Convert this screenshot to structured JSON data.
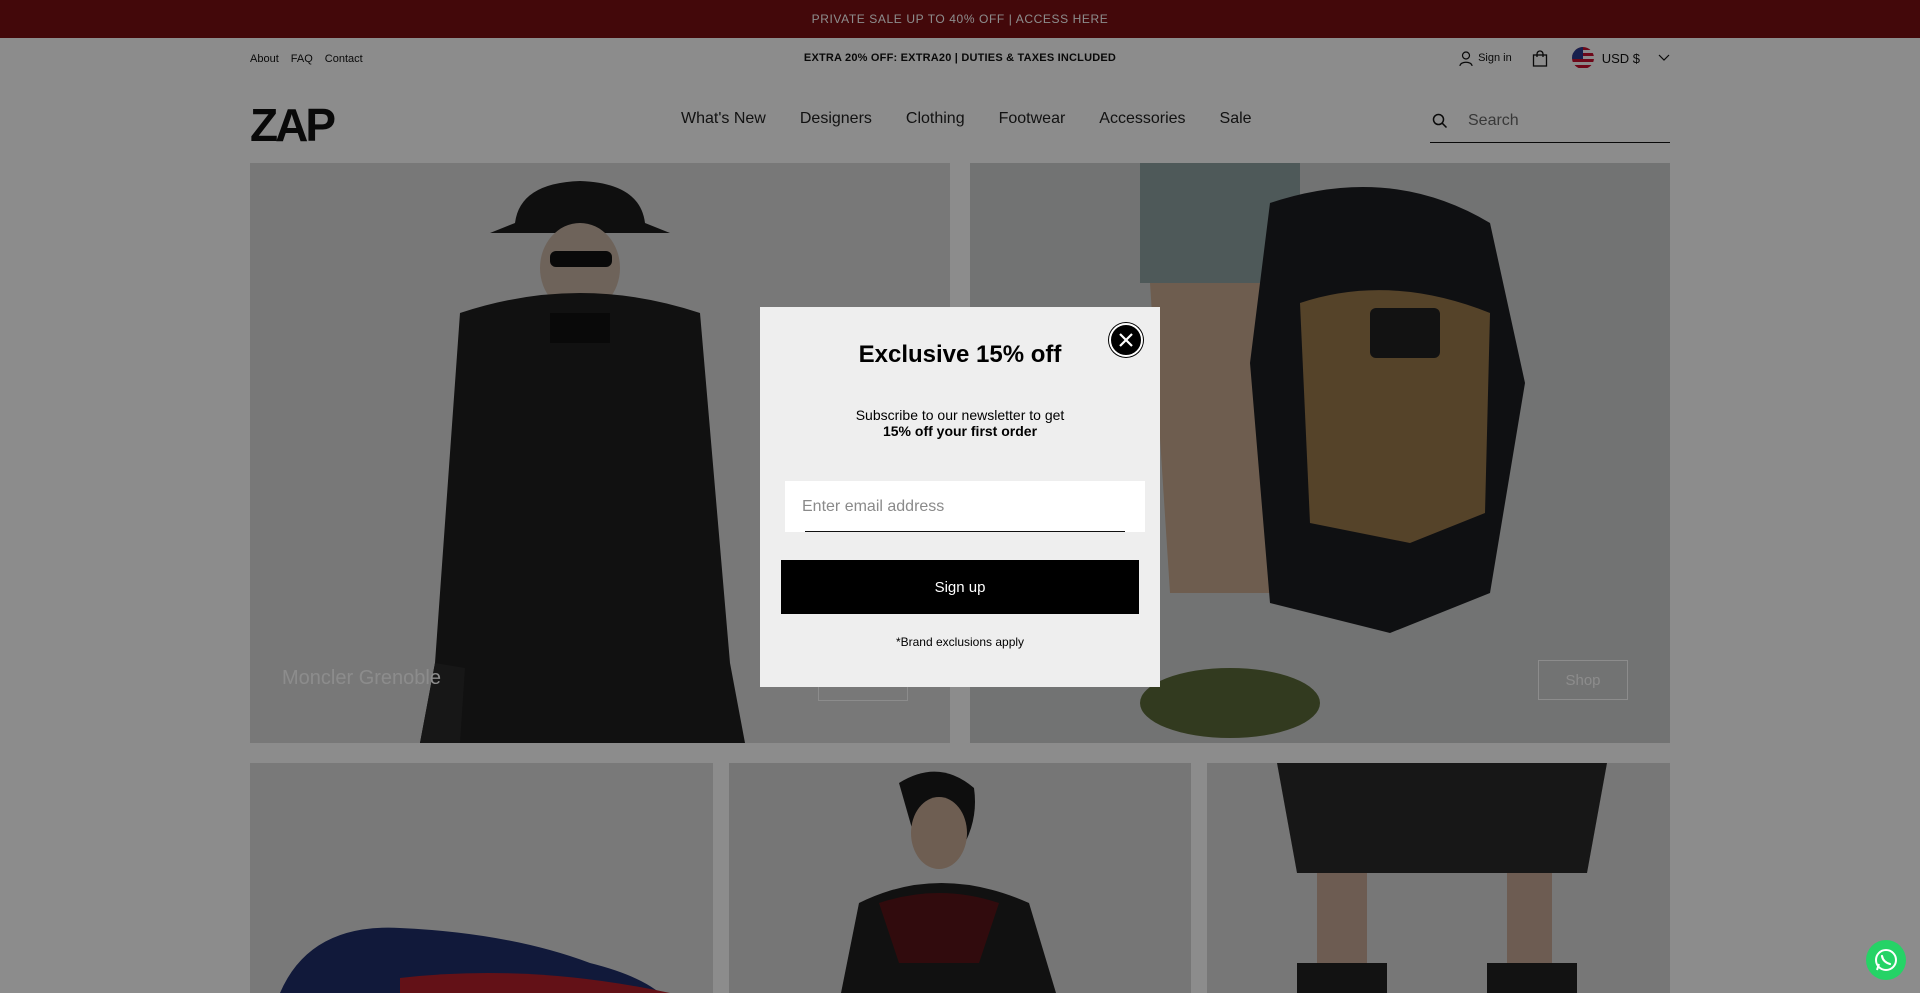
{
  "promo": {
    "text": "PRIVATE SALE UP TO 40% OFF | ACCESS HERE"
  },
  "utility": {
    "links": [
      "About",
      "FAQ",
      "Contact"
    ],
    "center_text": "EXTRA 20% OFF: EXTRA20 | DUTIES & TAXES INCLUDED",
    "signin_label": "Sign in",
    "currency_label": "USD $"
  },
  "header": {
    "logo_text": "ZAP",
    "nav": [
      "What's New",
      "Designers",
      "Clothing",
      "Footwear",
      "Accessories",
      "Sale"
    ],
    "search_placeholder": "Search"
  },
  "tiles": {
    "tile1": {
      "label": "Moncler Grenoble"
    },
    "tile2": {
      "shop_label": "Shop"
    }
  },
  "modal": {
    "title": "Exclusive 15% off",
    "subtitle_line1": "Subscribe to our newsletter to get",
    "subtitle_line2": "15% off your first order",
    "email_placeholder": "Enter email address",
    "signup_label": "Sign up",
    "disclaimer": "*Brand exclusions apply"
  },
  "colors": {
    "promo_bar": "#7a0f13",
    "button": "#000000",
    "whatsapp": "#25d366"
  }
}
